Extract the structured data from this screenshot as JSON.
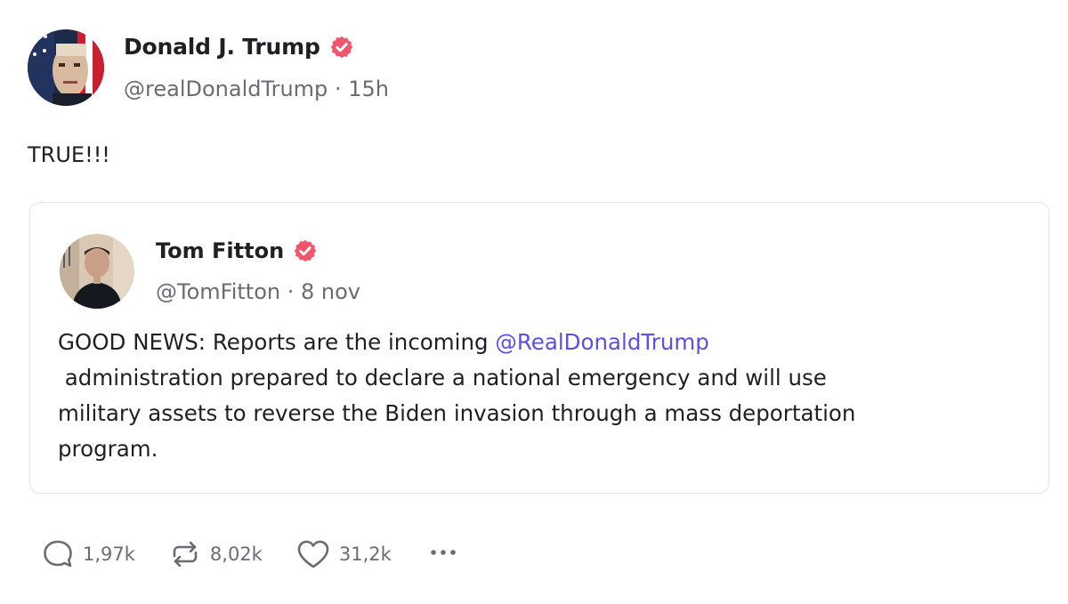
{
  "post": {
    "author_name": "Donald J. Trump",
    "handle": "@realDonaldTrump",
    "separator": "·",
    "time": "15h",
    "text": "TRUE!!!"
  },
  "quote": {
    "author_name": "Tom Fitton",
    "handle": "@TomFitton",
    "separator": "·",
    "date": "8 nov",
    "text_before": "GOOD NEWS: Reports are the incoming ",
    "mention": "@RealDonaldTrump",
    "line2": " administration prepared to declare a national emergency and will use",
    "line3": "military assets to reverse the Biden invasion through a mass deportation",
    "line4": "program."
  },
  "actions": {
    "replies": "1,97k",
    "reposts": "8,02k",
    "likes": "31,2k"
  },
  "icons": {
    "verified": "verified-badge-icon",
    "reply": "comment-bubble-icon",
    "repost": "repost-arrows-icon",
    "like": "heart-icon",
    "more": "more-dots-icon"
  },
  "colors": {
    "verified_badge": "#f0566d",
    "mention": "#5b4fe6",
    "muted_text": "#6b6b75",
    "border": "#e3e3e8"
  }
}
